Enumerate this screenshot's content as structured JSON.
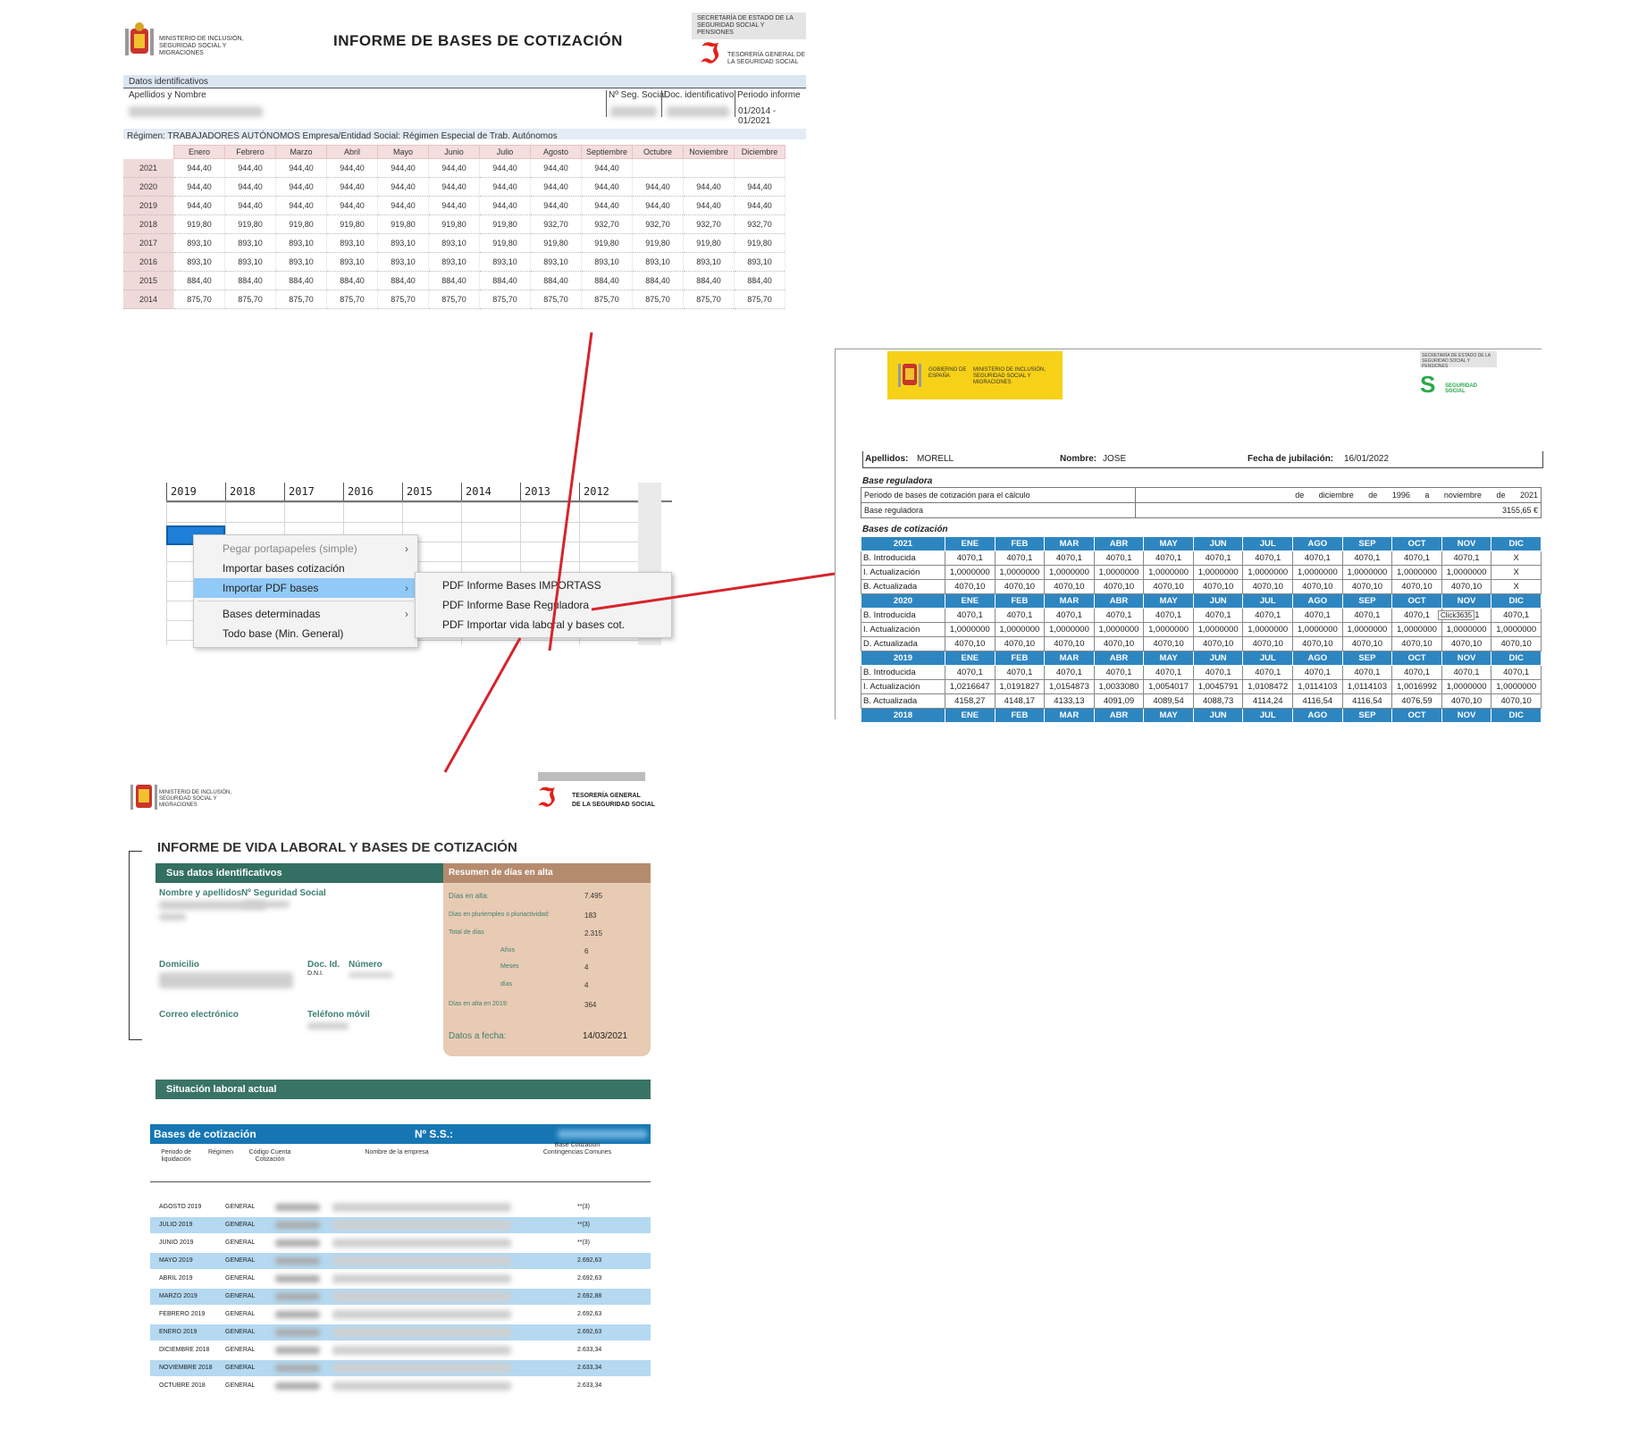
{
  "informe_importass": {
    "title": "INFORME DE BASES DE COTIZACIÓN",
    "ministry": "MINISTERIO DE INCLUSIÓN, SEGURIDAD SOCIAL Y MIGRACIONES",
    "secretaria": "SECRETARÍA DE ESTADO DE LA SEGURIDAD SOCIAL Y PENSIONES",
    "tgss": "TESORERÍA GENERAL DE LA SEGURIDAD SOCIAL",
    "datos_label": "Datos identificativos",
    "apellidos_label": "Apellidos y Nombre",
    "nss_label": "Nº Seg. Social",
    "doc_label": "Doc. identificativo",
    "periodo_label": "Periodo informe",
    "periodo_value": "01/2014 - 01/2021",
    "regimen": "Régimen: TRABAJADORES AUTÓNOMOS     Empresa/Entidad Social: Régimen Especial de Trab. Autónomos",
    "months": [
      "Enero",
      "Febrero",
      "Marzo",
      "Abril",
      "Mayo",
      "Junio",
      "Julio",
      "Agosto",
      "Septiembre",
      "Octubre",
      "Noviembre",
      "Diciembre"
    ],
    "rows": [
      {
        "year": "2021",
        "values": [
          "944,40",
          "944,40",
          "944,40",
          "944,40",
          "944,40",
          "944,40",
          "944,40",
          "944,40",
          "944,40",
          "",
          "",
          ""
        ]
      },
      {
        "year": "2020",
        "values": [
          "944,40",
          "944,40",
          "944,40",
          "944,40",
          "944,40",
          "944,40",
          "944,40",
          "944,40",
          "944,40",
          "944,40",
          "944,40",
          "944,40"
        ]
      },
      {
        "year": "2019",
        "values": [
          "944,40",
          "944,40",
          "944,40",
          "944,40",
          "944,40",
          "944,40",
          "944,40",
          "944,40",
          "944,40",
          "944,40",
          "944,40",
          "944,40"
        ]
      },
      {
        "year": "2018",
        "values": [
          "919,80",
          "919,80",
          "919,80",
          "919,80",
          "919,80",
          "919,80",
          "919,80",
          "932,70",
          "932,70",
          "932,70",
          "932,70",
          "932,70"
        ]
      },
      {
        "year": "2017",
        "values": [
          "893,10",
          "893,10",
          "893,10",
          "893,10",
          "893,10",
          "893,10",
          "919,80",
          "919,80",
          "919,80",
          "919,80",
          "919,80",
          "919,80"
        ]
      },
      {
        "year": "2016",
        "values": [
          "893,10",
          "893,10",
          "893,10",
          "893,10",
          "893,10",
          "893,10",
          "893,10",
          "893,10",
          "893,10",
          "893,10",
          "893,10",
          "893,10"
        ]
      },
      {
        "year": "2015",
        "values": [
          "884,40",
          "884,40",
          "884,40",
          "884,40",
          "884,40",
          "884,40",
          "884,40",
          "884,40",
          "884,40",
          "884,40",
          "884,40",
          "884,40"
        ]
      },
      {
        "year": "2014",
        "values": [
          "875,70",
          "875,70",
          "875,70",
          "875,70",
          "875,70",
          "875,70",
          "875,70",
          "875,70",
          "875,70",
          "875,70",
          "875,70",
          "875,70"
        ]
      }
    ]
  },
  "spreadsheet": {
    "years": [
      "2019",
      "2018",
      "2017",
      "2016",
      "2015",
      "2014",
      "2013",
      "2012"
    ],
    "menu": [
      {
        "label": "Pegar portapapeles (simple)",
        "has_submenu": true,
        "disabled": true
      },
      {
        "label": "Importar bases cotización",
        "has_submenu": false
      },
      {
        "label": "Importar PDF bases",
        "has_submenu": true,
        "highlighted": true
      },
      {
        "label": "Bases determinadas",
        "has_submenu": true
      },
      {
        "label": "Todo base (Min. General)",
        "has_submenu": false
      }
    ],
    "submenu": [
      "PDF Informe Bases IMPORTASS",
      "PDF Informe Base Reguladora",
      "PDF Importar vida laboral y bases cot."
    ]
  },
  "base_reguladora": {
    "gobierno": "GOBIERNO DE ESPAÑA",
    "ministerio": "MINISTERIO DE INCLUSIÓN, SEGURIDAD SOCIAL Y MIGRACIONES",
    "segsoc_top": "SECRETARÍA DE ESTADO DE LA SEGURIDAD SOCIAL Y PENSIONES",
    "segsoc_logo": "SEGURIDAD SOCIAL",
    "apellidos_label": "Apellidos:",
    "apellidos": "MORELL",
    "nombre_label": "Nombre:",
    "nombre": "JOSE",
    "fecha_label": "Fecha de jubilación:",
    "fecha": "16/01/2022",
    "base_reg_title": "Base reguladora",
    "periodo_label": "Periodo de bases de cotización para el cálculo",
    "periodo_de": "de",
    "periodo_m1": "diciembre",
    "periodo_de2": "de",
    "periodo_y1": "1996",
    "periodo_a": "a",
    "periodo_m2": "noviembre",
    "periodo_de3": "de",
    "periodo_y2": "2021",
    "base_label": "Base reguladora",
    "base_value": "3155,65 €",
    "bases_title": "Bases de cotización",
    "months": [
      "ENE",
      "FEB",
      "MAR",
      "ABR",
      "MAY",
      "JUN",
      "JUL",
      "AGO",
      "SEP",
      "OCT",
      "NOV",
      "DIC"
    ],
    "tooltip": "Click3635",
    "years": [
      {
        "year": "2021",
        "rows": [
          {
            "label": "B. Introducida",
            "values": [
              "4070,1",
              "4070,1",
              "4070,1",
              "4070,1",
              "4070,1",
              "4070,1",
              "4070,1",
              "4070,1",
              "4070,1",
              "4070,1",
              "4070,1",
              "X"
            ]
          },
          {
            "label": "I. Actualización",
            "values": [
              "1,0000000",
              "1,0000000",
              "1,0000000",
              "1,0000000",
              "1,0000000",
              "1,0000000",
              "1,0000000",
              "1,0000000",
              "1,0000000",
              "1,0000000",
              "1,0000000",
              "X"
            ]
          },
          {
            "label": "B. Actualizada",
            "values": [
              "4070,10",
              "4070,10",
              "4070,10",
              "4070,10",
              "4070,10",
              "4070,10",
              "4070,10",
              "4070,10",
              "4070,10",
              "4070,10",
              "4070,10",
              "X"
            ]
          }
        ]
      },
      {
        "year": "2020",
        "rows": [
          {
            "label": "B. Introducida",
            "values": [
              "4070,1",
              "4070,1",
              "4070,1",
              "4070,1",
              "4070,1",
              "4070,1",
              "4070,1",
              "4070,1",
              "4070,1",
              "4070,1",
              "4070,1",
              "4070,1"
            ]
          },
          {
            "label": "I. Actualización",
            "values": [
              "1,0000000",
              "1,0000000",
              "1,0000000",
              "1,0000000",
              "1,0000000",
              "1,0000000",
              "1,0000000",
              "1,0000000",
              "1,0000000",
              "1,0000000",
              "1,0000000",
              "1,0000000"
            ]
          },
          {
            "label": "D. Actualizada",
            "values": [
              "4070,10",
              "4070,10",
              "4070,10",
              "4070,10",
              "4070,10",
              "4070,10",
              "4070,10",
              "4070,10",
              "4070,10",
              "4070,10",
              "4070,10",
              "4070,10"
            ]
          }
        ]
      },
      {
        "year": "2019",
        "rows": [
          {
            "label": "B. Introducida",
            "values": [
              "4070,1",
              "4070,1",
              "4070,1",
              "4070,1",
              "4070,1",
              "4070,1",
              "4070,1",
              "4070,1",
              "4070,1",
              "4070,1",
              "4070,1",
              "4070,1"
            ]
          },
          {
            "label": "I. Actualización",
            "values": [
              "1,0216647",
              "1,0191827",
              "1,0154873",
              "1,0033080",
              "1,0054017",
              "1,0045791",
              "1,0108472",
              "1,0114103",
              "1,0114103",
              "1,0016992",
              "1,0000000",
              "1,0000000"
            ]
          },
          {
            "label": "B. Actualizada",
            "values": [
              "4158,27",
              "4148,17",
              "4133,13",
              "4091,09",
              "4089,54",
              "4088,73",
              "4114,24",
              "4116,54",
              "4116,54",
              "4076,59",
              "4070,10",
              "4070,10"
            ]
          }
        ]
      }
    ],
    "partial_year": "2018"
  },
  "vida_laboral": {
    "ministry": "MINISTERIO DE INCLUSIÓN, SEGURIDAD SOCIAL Y MIGRACIONES",
    "tgss_line1": "TESORERÍA GENERAL",
    "tgss_line2": "DE LA SEGURIDAD SOCIAL",
    "title": "INFORME DE VIDA LABORAL Y BASES DE COTIZACIÓN",
    "sus_datos": "Sus datos identificativos",
    "nombre_label": "Nombre y apellidos",
    "nss_label": "Nº Seguridad Social",
    "domicilio": "Domicilio",
    "doc_label": "Doc. Id.",
    "doc_type": "D.N.I.",
    "numero_label": "Número",
    "correo": "Correo electrónico",
    "telefono": "Teléfono móvil",
    "resumen": "Resumen de días en alta",
    "dias_alta_label": "Días en alta:",
    "dias_alta": "7.495",
    "pluriempleo_label": "Días en pluriempleo o pluriactividad:",
    "pluriempleo": "183",
    "total_label": "Total de días",
    "total": "2.315",
    "anos_label": "Años",
    "anos": "6",
    "meses_label": "Meses",
    "meses": "4",
    "dias_label": "días",
    "dias": "4",
    "alta2019_label": "Días en alta en 2019:",
    "alta2019": "364",
    "fecha_label": "Datos a fecha:",
    "fecha": "14/03/2021",
    "situacion": "Situación laboral actual",
    "bases_label": "Bases de cotización",
    "nss_short": "Nº S.S.:",
    "col_periodo": "Periodo de liquidación",
    "col_regimen": "Régimen",
    "col_ccc": "Código Cuenta Cotización",
    "col_empresa": "Nombre de la empresa",
    "col_base": "Base Cotización Contingencias Comunes",
    "rows": [
      {
        "periodo": "AGOSTO 2019",
        "regimen": "GENERAL",
        "base": "**(3)"
      },
      {
        "periodo": "JULIO 2019",
        "regimen": "GENERAL",
        "base": "**(3)"
      },
      {
        "periodo": "JUNIO 2019",
        "regimen": "GENERAL",
        "base": "**(3)"
      },
      {
        "periodo": "MAYO 2019",
        "regimen": "GENERAL",
        "base": "2.692,63"
      },
      {
        "periodo": "ABRIL 2019",
        "regimen": "GENERAL",
        "base": "2.692,63"
      },
      {
        "periodo": "MARZO 2019",
        "regimen": "GENERAL",
        "base": "2.692,88"
      },
      {
        "periodo": "FEBRERO 2019",
        "regimen": "GENERAL",
        "base": "2.692,63"
      },
      {
        "periodo": "ENERO 2019",
        "regimen": "GENERAL",
        "base": "2.692,63"
      },
      {
        "periodo": "DICIEMBRE 2018",
        "regimen": "GENERAL",
        "base": "2.633,34"
      },
      {
        "periodo": "NOVIEMBRE 2018",
        "regimen": "GENERAL",
        "base": "2.633,34"
      },
      {
        "periodo": "OCTUBRE 2018",
        "regimen": "GENERAL",
        "base": "2.633,34"
      }
    ]
  },
  "colors": {
    "connector": "#d6242b",
    "tgss_red": "#e32119",
    "header_blue": "#2e86c1",
    "green": "#336f63",
    "tan": "#e8cbb3",
    "menu_highlight": "#91c9f7"
  }
}
